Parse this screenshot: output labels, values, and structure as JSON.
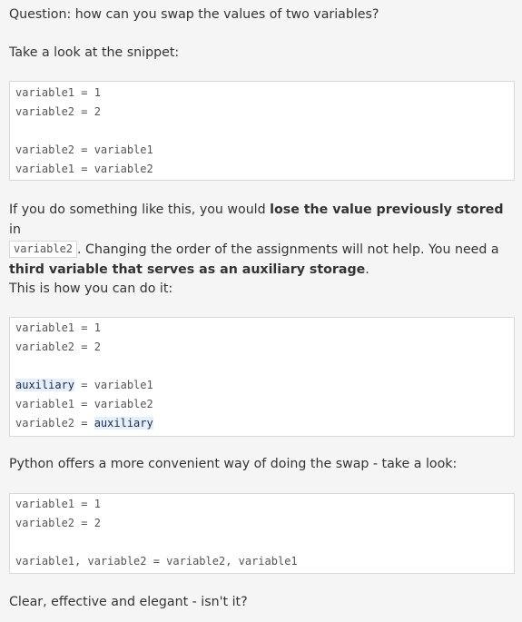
{
  "question": "Question: how can you swap the values of two variables?",
  "intro": "Take a look at the snippet:",
  "snippet1": {
    "line1": "variable1 = 1",
    "line2": "variable2 = 2",
    "line4": "variable2 = variable1",
    "line5": "variable1 = variable2"
  },
  "explanation": {
    "t1": "If you do something like this, you would ",
    "b1": "lose the value previously stored",
    "t2": " in",
    "code": "variable2",
    "t3": ". Changing the order of the assignments will not help. You need a ",
    "b2": "third variable that serves as an auxiliary storage",
    "t4": "."
  },
  "how_to": "This is how you can do it:",
  "snippet2": {
    "line1": "variable1 = 1",
    "line2": "variable2 = 2",
    "line4_hl": "auxiliary",
    "line4_rest": " = variable1",
    "line5": "variable1 = variable2",
    "line6_start": "variable2 = ",
    "line6_hl": "auxiliary"
  },
  "python_intro": "Python offers a more convenient way of doing the swap - take a look:",
  "snippet3": {
    "line1": "variable1 = 1",
    "line2": "variable2 = 2",
    "line4": "variable1, variable2 = variable2, variable1"
  },
  "conclusion": "Clear, effective and elegant - isn't it?"
}
